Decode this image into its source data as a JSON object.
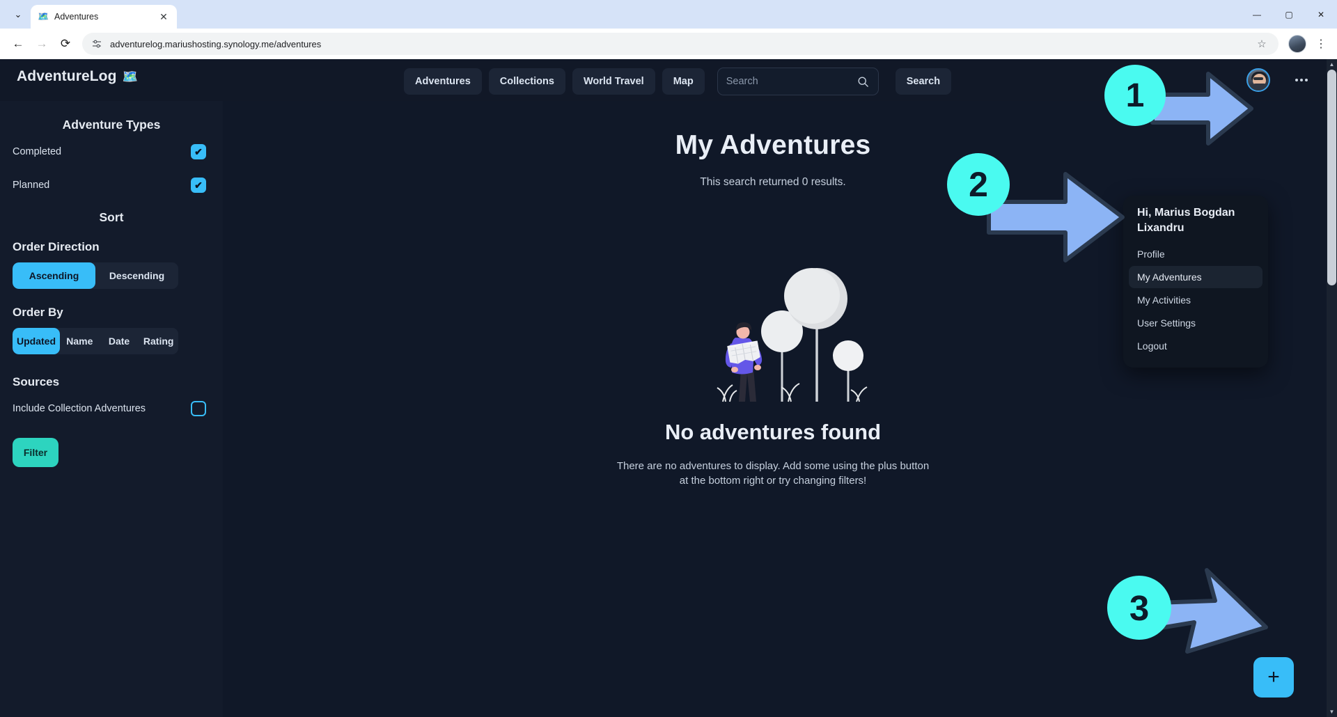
{
  "browser": {
    "tab": {
      "title": "Adventures",
      "favicon": "map-icon",
      "close_icon": "✕"
    },
    "tabstrip_chevron": "⌄",
    "window_controls": {
      "minimize": "—",
      "maximize": "▢",
      "close": "✕"
    },
    "nav": {
      "back": "←",
      "forward": "→",
      "reload": "⟳"
    },
    "omnibox": {
      "url": "adventurelog.mariushosting.synology.me/adventures",
      "site_info_icon": "tune-icon",
      "bookmark_icon": "☆"
    },
    "profile_icon": "account-avatar",
    "menu_icon": "⋮"
  },
  "app": {
    "brand": {
      "name": "AdventureLog",
      "emoji": "🗺️"
    },
    "nav_items": [
      {
        "label": "Adventures"
      },
      {
        "label": "Collections"
      },
      {
        "label": "World Travel"
      },
      {
        "label": "Map"
      }
    ],
    "search": {
      "placeholder": "Search",
      "value": "",
      "icon": "search-icon"
    },
    "search_button": "Search",
    "avatar_icon": "user-avatar",
    "overflow_icon": "ellipsis-icon"
  },
  "dropdown": {
    "greeting": "Hi, Marius Bogdan Lixandru",
    "items": [
      {
        "label": "Profile",
        "active": false
      },
      {
        "label": "My Adventures",
        "active": true
      },
      {
        "label": "My Activities",
        "active": false
      },
      {
        "label": "User Settings",
        "active": false
      },
      {
        "label": "Logout",
        "active": false
      }
    ]
  },
  "sidebar": {
    "adventure_types_title": "Adventure Types",
    "types": [
      {
        "label": "Completed",
        "checked": true
      },
      {
        "label": "Planned",
        "checked": true
      }
    ],
    "sort_title": "Sort",
    "order_direction_title": "Order Direction",
    "order_direction_options": [
      {
        "label": "Ascending",
        "selected": true
      },
      {
        "label": "Descending",
        "selected": false
      }
    ],
    "order_by_title": "Order By",
    "order_by_options": [
      {
        "label": "Updated",
        "selected": true
      },
      {
        "label": "Name",
        "selected": false
      },
      {
        "label": "Date",
        "selected": false
      },
      {
        "label": "Rating",
        "selected": false
      }
    ],
    "sources_title": "Sources",
    "sources": [
      {
        "label": "Include Collection Adventures",
        "checked": false
      }
    ],
    "filter_button": "Filter",
    "check_glyph": "✔"
  },
  "main": {
    "title": "My Adventures",
    "results_text": "This search returned 0 results.",
    "empty_title": "No adventures found",
    "empty_desc": "There are no adventures to display. Add some using the plus button at the bottom right or try changing filters!",
    "illustration": "person-with-map-and-trees",
    "fab_label": "+",
    "fab_icon": "plus-icon"
  },
  "annotations": [
    {
      "step": "1",
      "target": "avatar-button"
    },
    {
      "step": "2",
      "target": "my-adventures-menu-item"
    },
    {
      "step": "3",
      "target": "add-adventure-fab"
    }
  ],
  "colors": {
    "page_bg": "#101828",
    "panel_bg": "#131b2b",
    "accent_blue": "#38bdf8",
    "accent_teal": "#2dd4bf",
    "badge_cyan": "#4afaf0",
    "arrow_blue": "#8cb4f5",
    "text_primary": "#e9eef6",
    "text_secondary": "#c6d0de"
  },
  "scrollbar": {
    "up": "▲",
    "down": "▼"
  }
}
